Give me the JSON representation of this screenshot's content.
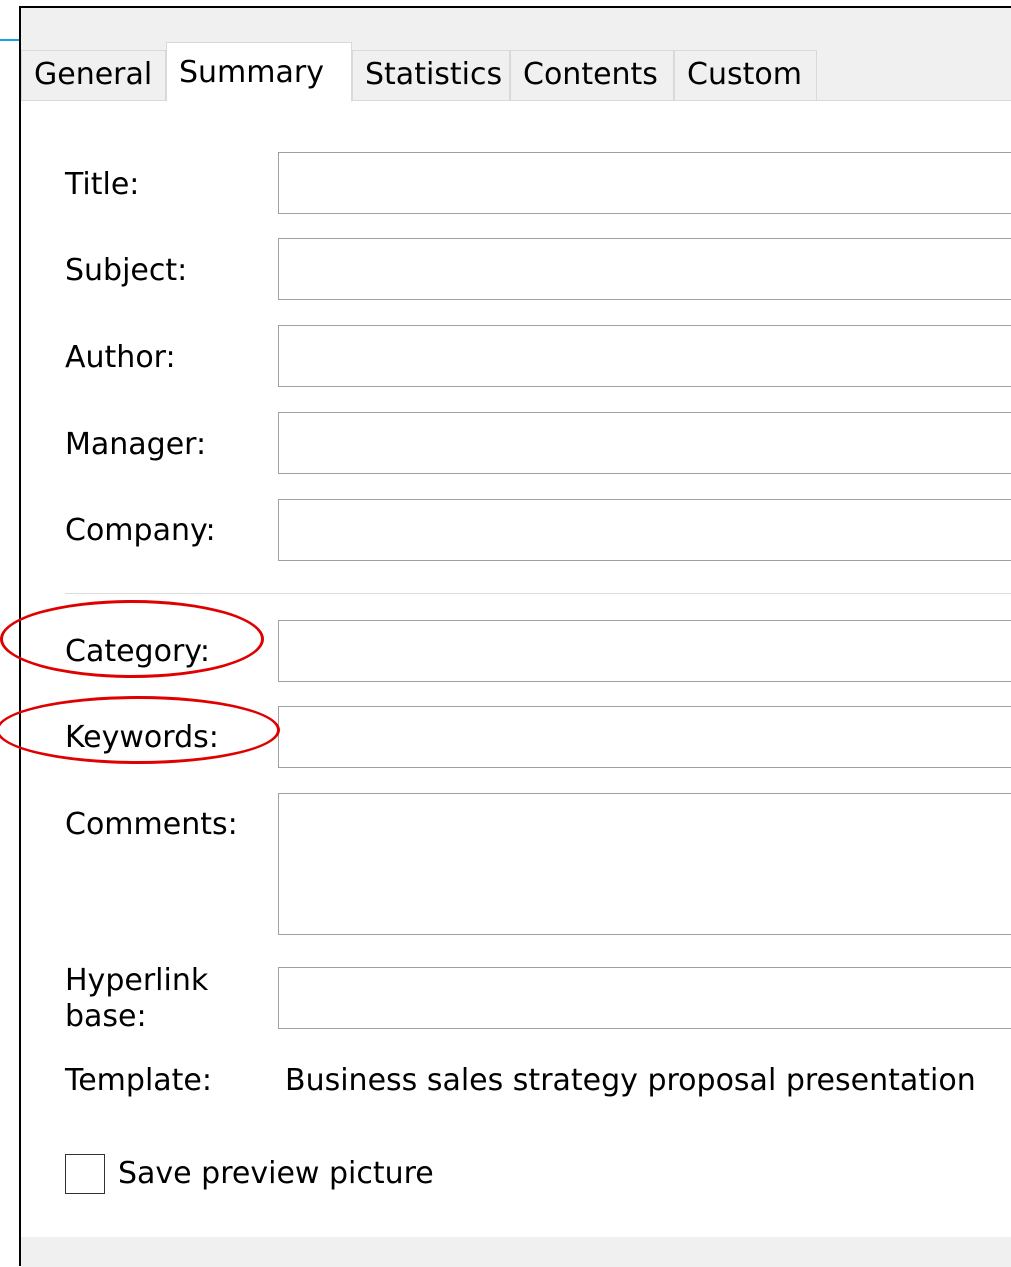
{
  "tabs": [
    {
      "label": "General"
    },
    {
      "label": "Summary",
      "active": true
    },
    {
      "label": "Statistics"
    },
    {
      "label": "Contents"
    },
    {
      "label": "Custom"
    }
  ],
  "fields": {
    "title": {
      "label": "Title:",
      "value": ""
    },
    "subject": {
      "label": "Subject:",
      "value": ""
    },
    "author": {
      "label": "Author:",
      "value": ""
    },
    "manager": {
      "label": "Manager:",
      "value": ""
    },
    "company": {
      "label": "Company:",
      "value": ""
    },
    "category": {
      "label": "Category:",
      "value": ""
    },
    "keywords": {
      "label": "Keywords:",
      "value": ""
    },
    "comments": {
      "label": "Comments:",
      "value": ""
    },
    "hyperlink_base": {
      "label_line1": "Hyperlink",
      "label_line2": "base:",
      "value": ""
    }
  },
  "template": {
    "label": "Template:",
    "value": "Business sales strategy proposal presentation"
  },
  "save_preview": {
    "label": "Save preview picture",
    "checked": false
  },
  "colors": {
    "annotation": "#e00000",
    "accent": "#1ba1e2"
  }
}
